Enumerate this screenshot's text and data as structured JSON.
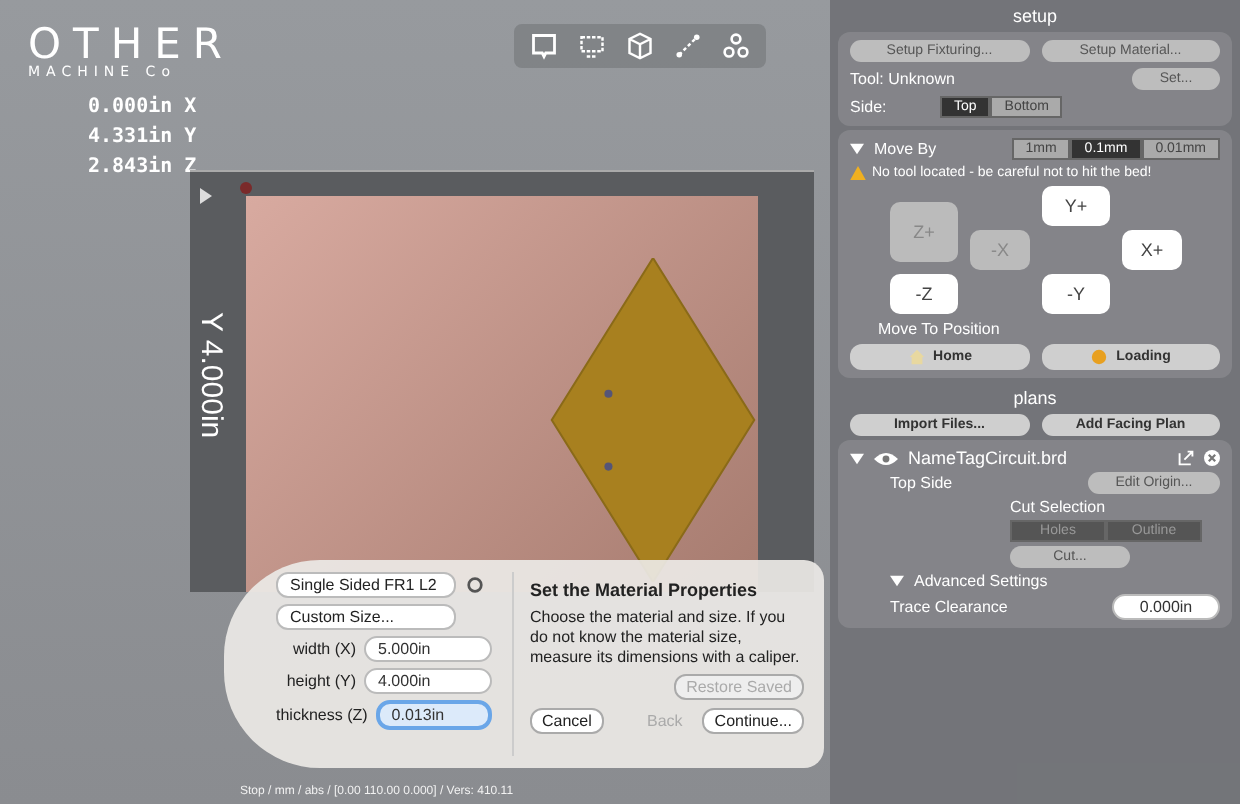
{
  "logo": {
    "name": "OTHER",
    "sub": "MACHINE Co"
  },
  "position": [
    {
      "value": "0.000in",
      "axis": "X"
    },
    {
      "value": "4.331in",
      "axis": "Y"
    },
    {
      "value": "2.843in",
      "axis": "Z"
    }
  ],
  "board": {
    "y_dimension": "Y 4.000in"
  },
  "dialog": {
    "material": "Single Sided FR1 L2",
    "size": "Custom Size...",
    "fields": [
      {
        "label": "width (X)",
        "value": "5.000in",
        "selected": false
      },
      {
        "label": "height (Y)",
        "value": "4.000in",
        "selected": false
      },
      {
        "label": "thickness (Z)",
        "value": "0.013in",
        "selected": true
      }
    ],
    "title": "Set the Material Properties",
    "text": "Choose the material and size. If you do not know the material size, measure its dimensions with a caliper.",
    "restore": {
      "label": "Restore Saved",
      "disabled": true
    },
    "cancel": "Cancel",
    "back": {
      "label": "Back",
      "disabled": true
    },
    "continue": "Continue..."
  },
  "status_bar": "Stop / mm / abs / [0.00 110.00 0.000] / Vers: 410.11",
  "setup": {
    "title": "setup",
    "buttons": [
      {
        "label": "Setup Fixturing...",
        "disabled": true
      },
      {
        "label": "Setup Material...",
        "disabled": true
      }
    ],
    "tool_label": "Tool: Unknown",
    "set_button": "Set...",
    "side_label": "Side:",
    "sides": [
      {
        "label": "Top",
        "selected": true
      },
      {
        "label": "Bottom",
        "selected": false
      }
    ]
  },
  "move": {
    "title": "Move By",
    "expanded": true,
    "steps": [
      {
        "label": "1mm",
        "selected": false
      },
      {
        "label": "0.1mm",
        "selected": true
      },
      {
        "label": "0.01mm",
        "selected": false
      }
    ],
    "warning": "No tool located - be careful not to hit the bed!",
    "jog": [
      {
        "label": "Z+",
        "kind": "zup",
        "disabled": true
      },
      {
        "label": "-X",
        "kind": "xminus",
        "disabled": true
      },
      {
        "label": "Y+",
        "kind": "yplus",
        "disabled": false
      },
      {
        "label": "X+",
        "kind": "xplus",
        "disabled": false
      },
      {
        "label": "-Z",
        "kind": "zdown",
        "disabled": false
      },
      {
        "label": "-Y",
        "kind": "yminus",
        "disabled": false
      }
    ],
    "position_title": "Move To Position",
    "home": "Home",
    "loading": "Loading"
  },
  "plans": {
    "title": "plans",
    "import": "Import Files...",
    "facing": "Add Facing Plan",
    "file": "NameTagCircuit.brd",
    "expanded": true,
    "side": "Top Side",
    "edit_origin": "Edit Origin...",
    "cut_selection": "Cut Selection",
    "cut_tabs": [
      {
        "label": "Holes",
        "selected": false
      },
      {
        "label": "Outline",
        "selected": false
      }
    ],
    "cut_button": "Cut...",
    "advanced": "Advanced Settings",
    "clearance_label": "Trace Clearance",
    "clearance": "0.000in"
  }
}
